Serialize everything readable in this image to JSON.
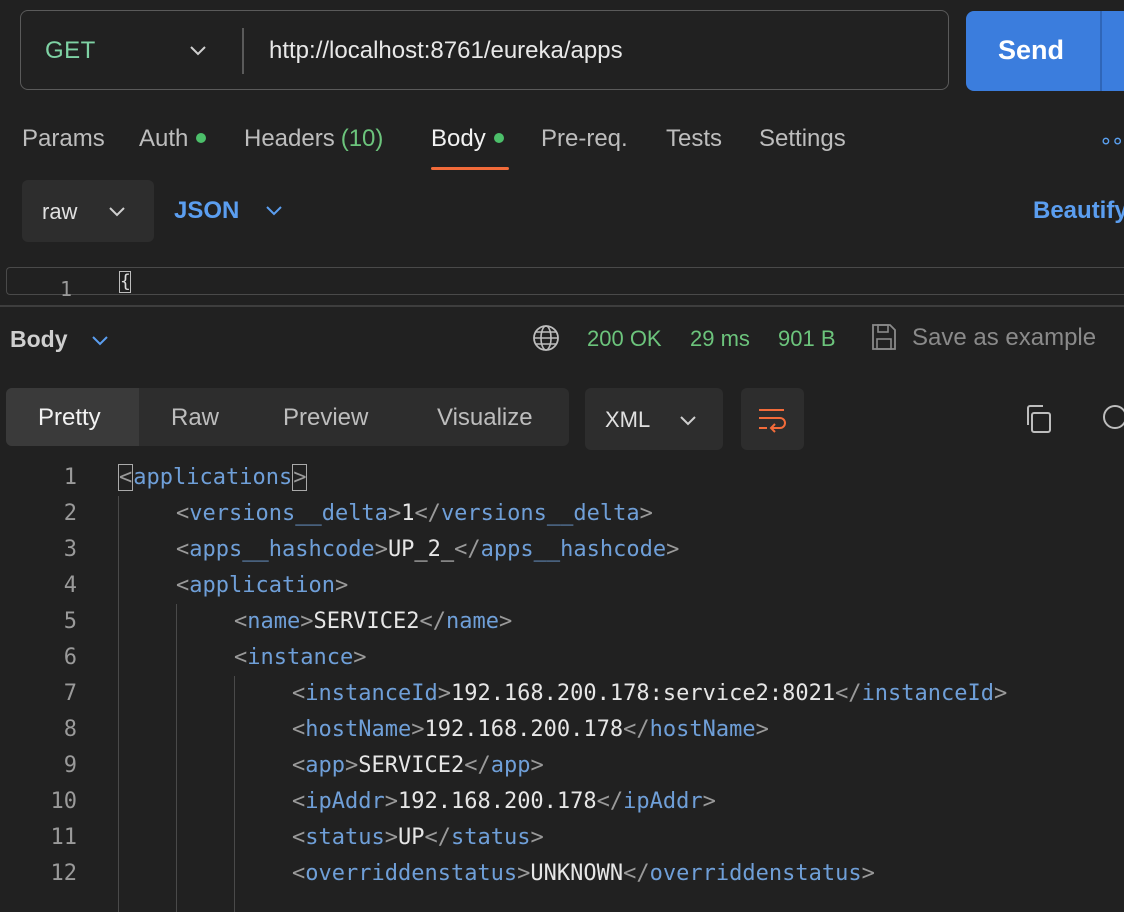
{
  "request": {
    "method": "GET",
    "url": "http://localhost:8761/eureka/apps",
    "send_label": "Send"
  },
  "request_tabs": [
    {
      "label": "Params"
    },
    {
      "label": "Auth"
    },
    {
      "label": "Headers",
      "count": "(10)"
    },
    {
      "label": "Body"
    },
    {
      "label": "Pre-req."
    },
    {
      "label": "Tests"
    },
    {
      "label": "Settings"
    }
  ],
  "body_options": {
    "mode": "raw",
    "format": "JSON",
    "beautify_label": "Beautify"
  },
  "request_editor": {
    "line_number": "1",
    "first_char": "{"
  },
  "response": {
    "section_label": "Body",
    "status": "200 OK",
    "time": "29 ms",
    "size": "901 B",
    "save_label": "Save as example",
    "views": [
      "Pretty",
      "Raw",
      "Preview",
      "Visualize"
    ],
    "format": "XML"
  },
  "code_lines": [
    {
      "n": "1",
      "indent": 0,
      "tag": "applications",
      "text": null,
      "open_only": true
    },
    {
      "n": "2",
      "indent": 1,
      "tag": "versions__delta",
      "text": "1"
    },
    {
      "n": "3",
      "indent": 1,
      "tag": "apps__hashcode",
      "text": "UP_2_"
    },
    {
      "n": "4",
      "indent": 1,
      "tag": "application",
      "text": null,
      "open_only": true
    },
    {
      "n": "5",
      "indent": 2,
      "tag": "name",
      "text": "SERVICE2"
    },
    {
      "n": "6",
      "indent": 2,
      "tag": "instance",
      "text": null,
      "open_only": true
    },
    {
      "n": "7",
      "indent": 3,
      "tag": "instanceId",
      "text": "192.168.200.178:service2:8021"
    },
    {
      "n": "8",
      "indent": 3,
      "tag": "hostName",
      "text": "192.168.200.178"
    },
    {
      "n": "9",
      "indent": 3,
      "tag": "app",
      "text": "SERVICE2"
    },
    {
      "n": "10",
      "indent": 3,
      "tag": "ipAddr",
      "text": "192.168.200.178"
    },
    {
      "n": "11",
      "indent": 3,
      "tag": "status",
      "text": "UP"
    },
    {
      "n": "12",
      "indent": 3,
      "tag": "overriddenstatus",
      "text": "UNKNOWN"
    }
  ],
  "colors": {
    "accent": "#3b7ddd",
    "success": "#6cc47c",
    "tab_underline": "#f26b3a",
    "xml_tag": "#6f9fd8"
  }
}
